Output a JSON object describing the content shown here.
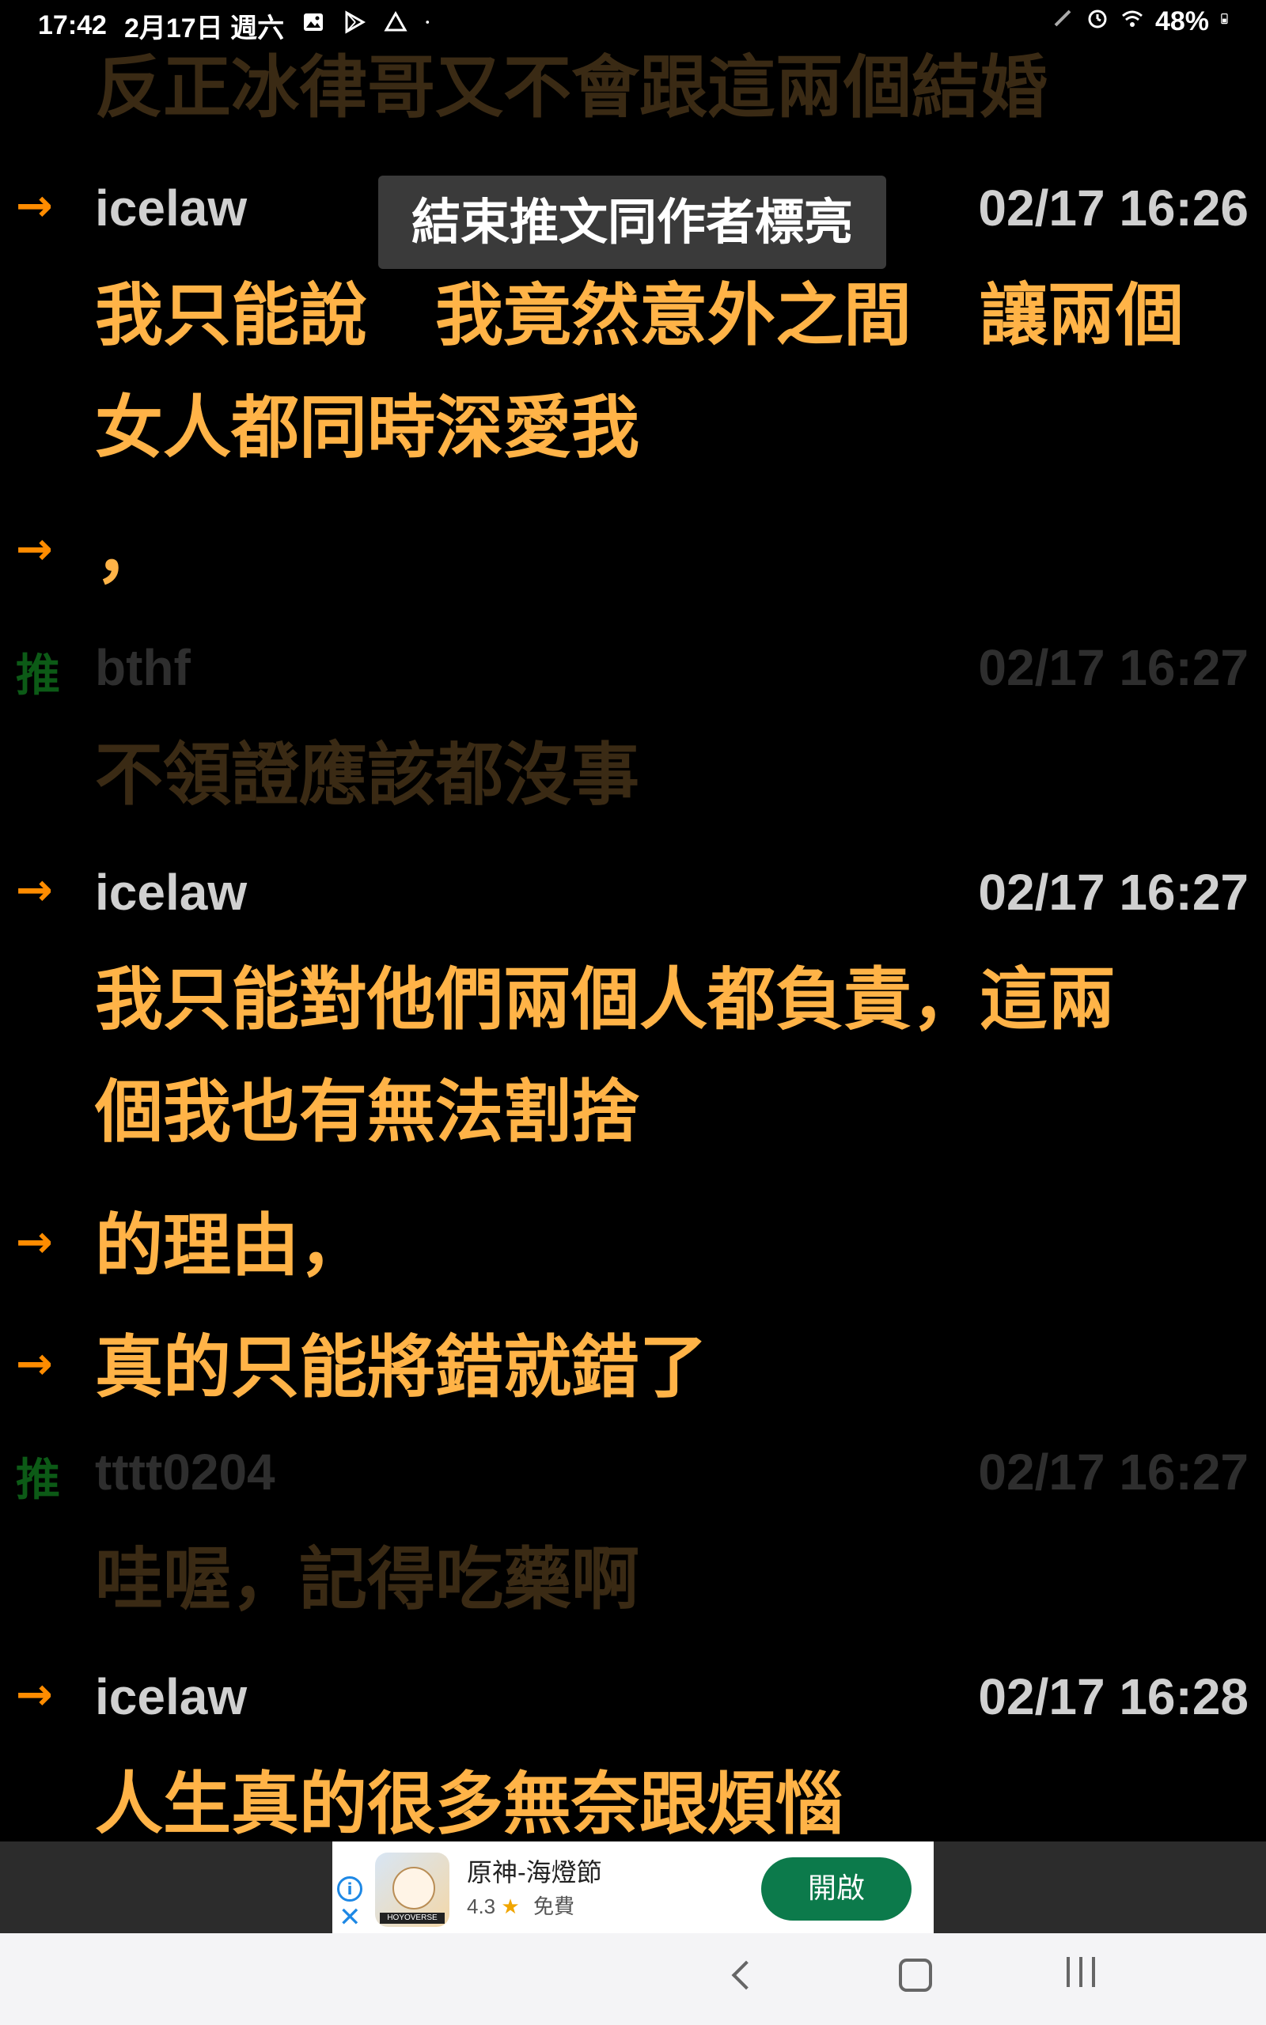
{
  "status_bar": {
    "time": "17:42",
    "date": "2月17日 週六",
    "battery": "48%",
    "icons": [
      "gallery-icon",
      "play-store-icon",
      "drive-icon",
      "dot-icon",
      "pen-icon",
      "alarm-icon",
      "wifi-icon",
      "battery-icon"
    ]
  },
  "tooltip": {
    "text": "結束推文同作者標亮"
  },
  "comments": [
    {
      "tag": "",
      "user": "",
      "time": "",
      "lines": [
        "反正冰律哥又不會跟這兩個結婚"
      ],
      "style": "dim"
    },
    {
      "tag": "→",
      "user": "icelaw",
      "time": "02/17 16:26",
      "lines": [
        "我只能說　我竟然意外之間　讓兩個",
        "女人都同時深愛我"
      ],
      "style": "hi"
    },
    {
      "tag": "→",
      "user": "",
      "time": "",
      "lines": [
        "，"
      ],
      "style": "hi"
    },
    {
      "tag": "推",
      "user": "bthf",
      "time": "02/17 16:27",
      "lines": [
        "不領證應該都沒事"
      ],
      "style": "dim"
    },
    {
      "tag": "→",
      "user": "icelaw",
      "time": "02/17 16:27",
      "lines": [
        "我只能對他們兩個人都負責，這兩",
        "個我也有無法割捨"
      ],
      "style": "hi"
    },
    {
      "tag": "→",
      "user": "",
      "time": "",
      "lines": [
        "的理由，"
      ],
      "style": "hi"
    },
    {
      "tag": "→",
      "user": "",
      "time": "",
      "lines": [
        "真的只能將錯就錯了"
      ],
      "style": "hi"
    },
    {
      "tag": "推",
      "user": "tttt0204",
      "time": "02/17 16:27",
      "lines": [
        "哇喔，記得吃藥啊"
      ],
      "style": "dim"
    },
    {
      "tag": "→",
      "user": "icelaw",
      "time": "02/17 16:28",
      "lines": [
        "人生真的很多無奈跟煩惱"
      ],
      "style": "hi"
    }
  ],
  "ad": {
    "app_name": "原神-海燈節",
    "rating": "4.3",
    "price": "免費",
    "brand": "HOYOVERSE",
    "button_label": "開啟"
  },
  "nav": {
    "icons": [
      "back-icon",
      "home-icon",
      "recents-icon"
    ]
  }
}
